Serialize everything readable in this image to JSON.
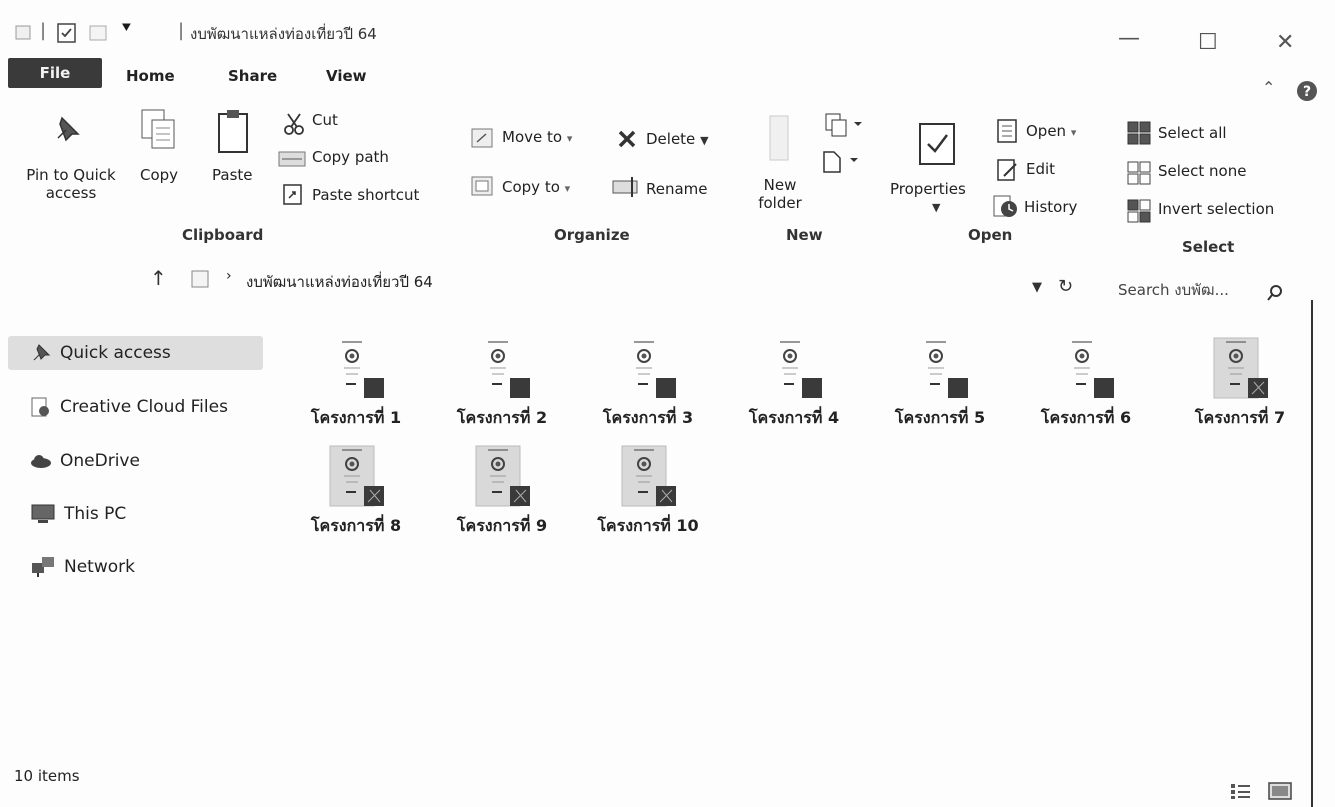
{
  "window": {
    "title": "งบพัฒนาแหล่งท่องเที่ยวปี 64",
    "minimize": "—",
    "maximize": "☐",
    "close": "✕"
  },
  "tabs": [
    "File",
    "Home",
    "Share",
    "View"
  ],
  "ribbon": {
    "clipboard": {
      "pin_label": "Pin to Quick access",
      "copy_label": "Copy",
      "paste_label": "Paste",
      "cut_label": "Cut",
      "copy_path_label": "Copy path",
      "paste_shortcut_label": "Paste shortcut",
      "group_label": "Clipboard"
    },
    "organize": {
      "move_to_label": "Move to",
      "copy_to_label": "Copy to",
      "delete_label": "Delete",
      "rename_label": "Rename",
      "group_label": "Organize"
    },
    "new": {
      "new_folder_label": "New folder",
      "group_label": "New"
    },
    "open": {
      "properties_label": "Properties",
      "open_label": "Open",
      "edit_label": "Edit",
      "history_label": "History",
      "group_label": "Open"
    },
    "select": {
      "select_all_label": "Select all",
      "select_none_label": "Select none",
      "invert_label": "Invert selection",
      "group_label": "Select"
    }
  },
  "address": {
    "path": "งบพัฒนาแหล่งท่องเที่ยวปี 64",
    "search_placeholder": "Search งบพัฒ..."
  },
  "nav": [
    {
      "label": "Quick access",
      "icon": "pin-icon"
    },
    {
      "label": "Creative Cloud Files",
      "icon": "cloud-files-icon"
    },
    {
      "label": "OneDrive",
      "icon": "onedrive-icon"
    },
    {
      "label": "This PC",
      "icon": "pc-icon"
    },
    {
      "label": "Network",
      "icon": "network-icon"
    }
  ],
  "files": [
    {
      "name": "โครงการที่ 1"
    },
    {
      "name": "โครงการที่ 2"
    },
    {
      "name": "โครงการที่ 3"
    },
    {
      "name": "โครงการที่ 4"
    },
    {
      "name": "โครงการที่ 5"
    },
    {
      "name": "โครงการที่ 6"
    },
    {
      "name": "โครงการที่ 7"
    },
    {
      "name": "โครงการที่ 8"
    },
    {
      "name": "โครงการที่ 9"
    },
    {
      "name": "โครงการที่ 10"
    }
  ],
  "status": {
    "item_count": "10 items"
  }
}
